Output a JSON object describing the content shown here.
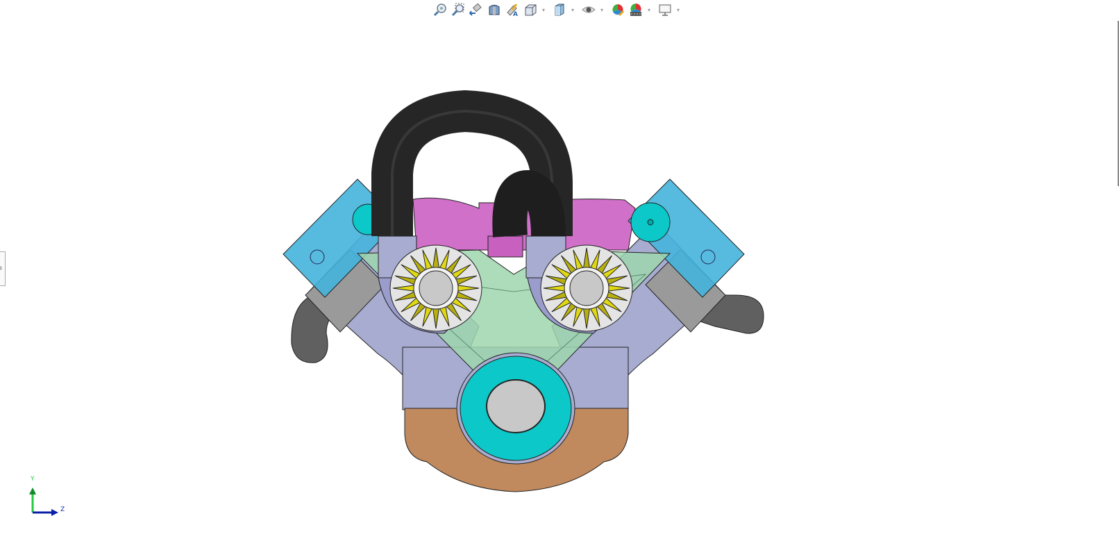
{
  "toolbar": {
    "items": [
      {
        "icon": "zoom-to-fit-icon",
        "dropdown": false
      },
      {
        "icon": "zoom-to-area-icon",
        "dropdown": false
      },
      {
        "icon": "previous-view-icon",
        "dropdown": false
      },
      {
        "icon": "section-view-icon",
        "dropdown": false
      },
      {
        "icon": "dynamic-annotation-views-icon",
        "dropdown": false
      },
      {
        "icon": "view-orientation-icon",
        "dropdown": true
      },
      {
        "icon": "display-style-icon",
        "dropdown": true
      },
      {
        "icon": "hide-show-items-icon",
        "dropdown": true
      },
      {
        "icon": "edit-appearance-icon",
        "dropdown": false
      },
      {
        "icon": "apply-scene-icon",
        "dropdown": true
      },
      {
        "icon": "view-settings-icon",
        "dropdown": true
      }
    ],
    "dropdown_glyph": "▾"
  },
  "triad": {
    "y_label": "Y",
    "z_label": "Z",
    "y_color": "#22c940",
    "z_color": "#0a1fa8"
  },
  "colors": {
    "hose": "#262626",
    "head_blue": "#45b4dc",
    "block_gray": "#9a9a9a",
    "block_lavender": "#a8acd0",
    "valley_green": "#9fd6ae",
    "pulley_cyan": "#0cc8c8",
    "oil_pan": "#c08a5e",
    "intake_pink": "#d070c8",
    "gear_yellow": "#e0d810"
  }
}
